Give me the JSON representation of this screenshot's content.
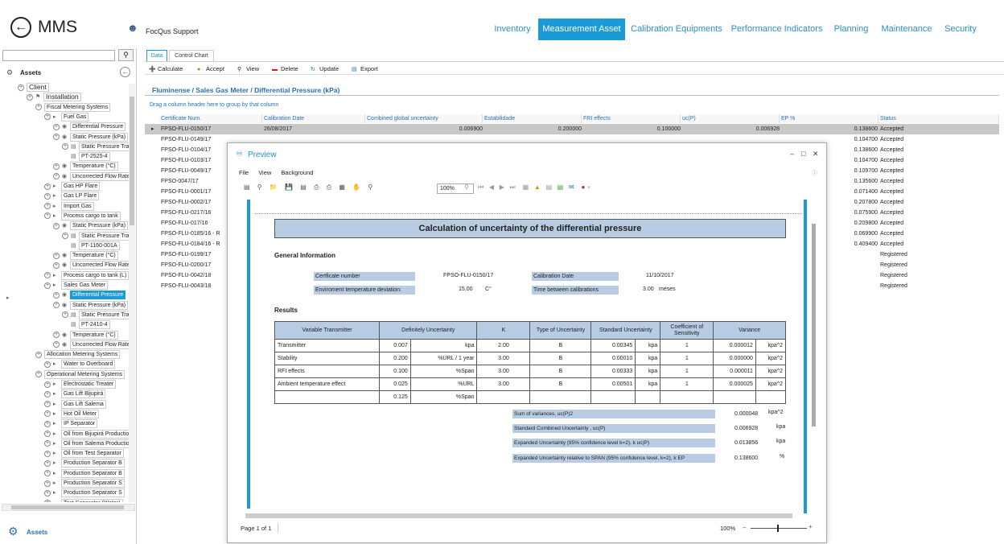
{
  "header": {
    "app_title": "MMS",
    "user": "FocQus Support",
    "nav": [
      {
        "label": "Inventory",
        "active": false
      },
      {
        "label": "Measurement Asset",
        "active": true
      },
      {
        "label": "Calibration Equipments",
        "active": false
      },
      {
        "label": "Performance Indicators",
        "active": false
      },
      {
        "label": "Planning",
        "active": false
      },
      {
        "label": "Maintenance",
        "active": false
      },
      {
        "label": "Security",
        "active": false
      }
    ]
  },
  "left": {
    "search_placeholder": "",
    "assets_header": "Assets",
    "bottom_label": "Assets",
    "tree": [
      {
        "label": "Client"
      },
      {
        "label": "Installation"
      },
      {
        "label": "Fiscal Metering Systems"
      },
      {
        "label": "Fuel Gas"
      },
      {
        "label": "Differential Pressure"
      },
      {
        "label": "Static Pressure (kPa)"
      },
      {
        "label": "Static Pressure Transmitter"
      },
      {
        "label": "PT-2525-4"
      },
      {
        "label": "Temperature (°C)"
      },
      {
        "label": "Uncorrected Flow Rate"
      },
      {
        "label": "Gas HP Flare"
      },
      {
        "label": "Gas LP Flare"
      },
      {
        "label": "Import Gas"
      },
      {
        "label": "Process cargo to tank"
      },
      {
        "label": "Static Pressure (kPa)"
      },
      {
        "label": "Static Pressure Transmitter"
      },
      {
        "label": "PT-1160-001A"
      },
      {
        "label": "Temperature (°C)"
      },
      {
        "label": "Uncorrected Flow Rate"
      },
      {
        "label": "Process cargo to tank (L)"
      },
      {
        "label": "Sales Gas Meter"
      },
      {
        "label": "Differential Pressure"
      },
      {
        "label": "Static Pressure (kPa)"
      },
      {
        "label": "Static Pressure Transmitter"
      },
      {
        "label": "PT-2410-4"
      },
      {
        "label": "Temperature (°C)"
      },
      {
        "label": "Uncorrected Flow Rate"
      },
      {
        "label": "Allocation Metering Systems"
      },
      {
        "label": "Water to Overboard"
      },
      {
        "label": "Operational Metering Systems"
      },
      {
        "label": "Electrostatic Treater"
      },
      {
        "label": "Gas Lift Bijupirá"
      },
      {
        "label": "Gas Lift Salema"
      },
      {
        "label": "Hot Oil Meter"
      },
      {
        "label": "IP Separator"
      },
      {
        "label": "Oil from Bijupirá Production"
      },
      {
        "label": "Oil from Salema Production"
      },
      {
        "label": "Oil from Test Separator"
      },
      {
        "label": "Production Separator B"
      },
      {
        "label": "Production Separator B"
      },
      {
        "label": "Production Separator S"
      },
      {
        "label": "Production Separator S"
      },
      {
        "label": "Test Separator (Water)"
      }
    ]
  },
  "tabs": [
    "Data",
    "Control Chart"
  ],
  "toolbar": [
    "Calculate",
    "Accept",
    "View",
    "Delete",
    "Update",
    "Export"
  ],
  "breadcrumb": "Fluminense / Sales Gas Meter / Differential Pressure (kPa)",
  "group_hint": "Drag a column header here to group by that column",
  "grid": {
    "columns": [
      "Certificate Num.",
      "Calibration Date",
      "Combined global uncertainty",
      "Estabilidade",
      "FRI effects",
      "uc(P)",
      "EP %",
      "Status"
    ],
    "rows": [
      [
        "FPSO-FLU-0150/17",
        "26/08/2017",
        "0.006900",
        "0.200000",
        "0.100000",
        "0.006928",
        "0.138600",
        "Accepted"
      ],
      [
        "FPSO-FLU-0149/17",
        "",
        "",
        "",
        "",
        "",
        "0.104700",
        "Accepted"
      ],
      [
        "FPSO-FLU-0104/17",
        "",
        "",
        "",
        "",
        "",
        "0.138600",
        "Accepted"
      ],
      [
        "FPSO-FLU-0103/17",
        "",
        "",
        "",
        "",
        "",
        "0.104700",
        "Accepted"
      ],
      [
        "FPSO-FLU-0049/17",
        "",
        "",
        "",
        "",
        "",
        "0.109700",
        "Accepted"
      ],
      [
        "FPSO-0047/17",
        "",
        "",
        "",
        "",
        "",
        "0.135600",
        "Accepted"
      ],
      [
        "FPSO-FLU-0001/17",
        "",
        "",
        "",
        "",
        "",
        "0.071400",
        "Accepted"
      ],
      [
        "FPSO-FLU-0002/17",
        "",
        "",
        "",
        "",
        "",
        "0.207800",
        "Accepted"
      ],
      [
        "FPSO-FLU-0217/16",
        "",
        "",
        "",
        "",
        "",
        "0.075900",
        "Accepted"
      ],
      [
        "FPSO-FLU-017/16",
        "",
        "",
        "",
        "",
        "",
        "0.209800",
        "Accepted"
      ],
      [
        "FPSO-FLU-0185/16 - R",
        "",
        "",
        "",
        "",
        "",
        "0.069900",
        "Accepted"
      ],
      [
        "FPSO-FLU-0184/16 - R",
        "",
        "",
        "",
        "",
        "",
        "0.409400",
        "Accepted"
      ],
      [
        "FPSO-FLU-0199/17",
        "",
        "",
        "",
        "",
        "",
        "",
        "Registered"
      ],
      [
        "FPSO-FLU-0200/17",
        "",
        "",
        "",
        "",
        "",
        "",
        "Registered"
      ],
      [
        "FPSO-FLU-0042/18",
        "",
        "",
        "",
        "",
        "",
        "",
        "Registered"
      ],
      [
        "FPSO-FLU-0043/18",
        "",
        "",
        "",
        "",
        "",
        "",
        "Registered"
      ]
    ]
  },
  "preview": {
    "title": "Preview",
    "menu": [
      "File",
      "View",
      "Background"
    ],
    "zoom": "100%",
    "page_status": "Page 1 of 1",
    "zoom_pct": "100%",
    "doc": {
      "title": "Calculation of uncertainty of the differential pressure",
      "general_info": "General Information",
      "cert_label": "Certficate number",
      "cert_value": "FPSO-FLU-0150/17",
      "cal_date_label": "Calibration Date",
      "cal_date_value": "11/10/2017",
      "env_label": "Enviroment temperature deviation:",
      "env_value": "15.00",
      "env_unit": "C°",
      "time_label": "Time between calibrations",
      "time_value": "3.00",
      "time_unit": "meses",
      "results": "Results",
      "table_headers": [
        "Variable Transmitter",
        "Definitely Uncertainty",
        "K",
        "Type of Uncertainty",
        "Standard Uncertainty",
        "Coefficient of Sensitivity",
        "Variance"
      ],
      "table_rows": [
        [
          "Transmitter",
          "0.007",
          "kpa",
          "2.00",
          "B",
          "0.00345",
          "kpa",
          "1",
          "0.000012",
          "kpa^2"
        ],
        [
          "Stability",
          "0.200",
          "%URL / 1 year",
          "3.00",
          "B",
          "0.00010",
          "kpa",
          "1",
          "0.000000",
          "kpa^2"
        ],
        [
          "RFI effects",
          "0.100",
          "%Span",
          "3.00",
          "B",
          "0.00333",
          "kpa",
          "1",
          "0.000011",
          "kpa^2"
        ],
        [
          "Ambient temperature effect",
          "0.025",
          "%URL",
          "3.00",
          "B",
          "0.00501",
          "kpa",
          "1",
          "0.000025",
          "kpa^2"
        ],
        [
          "",
          "0.125",
          "%Span",
          "",
          "",
          "",
          "",
          "",
          "",
          ""
        ]
      ],
      "summary": [
        {
          "label": "Sum of variances, uc(P)2",
          "value": "0.000048",
          "unit": "kpa^2"
        },
        {
          "label": "Standard Combined Uncertainty , uc(P)",
          "value": "0.006928",
          "unit": "kpa"
        },
        {
          "label": "Expanded Uncertainty (95% confidence level k=2), k uc(P)",
          "value": "0.013856",
          "unit": "kpa"
        },
        {
          "label": "Expanded Uncertainty relative to SPAN (95% confidence level, k=2), k EP",
          "value": "0.138600",
          "unit": "%"
        }
      ]
    }
  }
}
